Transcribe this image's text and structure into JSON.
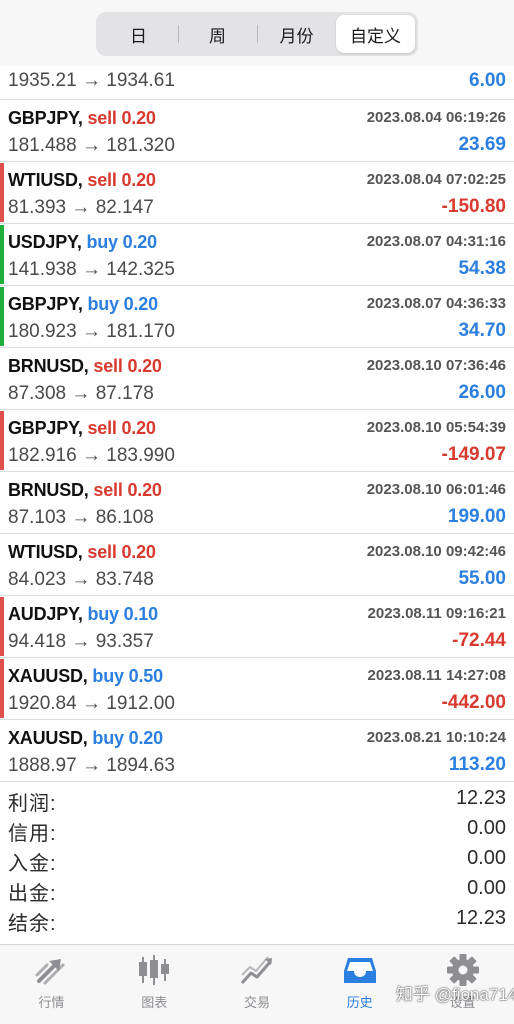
{
  "period_tabs": [
    {
      "label": "日"
    },
    {
      "label": "周"
    },
    {
      "label": "月份"
    },
    {
      "label": "自定义"
    }
  ],
  "active_period_index": 3,
  "partial_row": {
    "open": "1935.21",
    "close": "1934.61",
    "profit": "6.00"
  },
  "deals": [
    {
      "symbol": "GBPJPY,",
      "direction": "sell",
      "volume": "0.20",
      "time": "2023.08.04 06:19:26",
      "open": "181.488",
      "close": "181.320",
      "profit": "23.69",
      "indicator": "none"
    },
    {
      "symbol": "WTIUSD,",
      "direction": "sell",
      "volume": "0.20",
      "time": "2023.08.04 07:02:25",
      "open": "81.393",
      "close": "82.147",
      "profit": "-150.80",
      "indicator": "red"
    },
    {
      "symbol": "USDJPY,",
      "direction": "buy",
      "volume": "0.20",
      "time": "2023.08.07 04:31:16",
      "open": "141.938",
      "close": "142.325",
      "profit": "54.38",
      "indicator": "green"
    },
    {
      "symbol": "GBPJPY,",
      "direction": "buy",
      "volume": "0.20",
      "time": "2023.08.07 04:36:33",
      "open": "180.923",
      "close": "181.170",
      "profit": "34.70",
      "indicator": "green"
    },
    {
      "symbol": "BRNUSD,",
      "direction": "sell",
      "volume": "0.20",
      "time": "2023.08.10 07:36:46",
      "open": "87.308",
      "close": "87.178",
      "profit": "26.00",
      "indicator": "none"
    },
    {
      "symbol": "GBPJPY,",
      "direction": "sell",
      "volume": "0.20",
      "time": "2023.08.10 05:54:39",
      "open": "182.916",
      "close": "183.990",
      "profit": "-149.07",
      "indicator": "red"
    },
    {
      "symbol": "BRNUSD,",
      "direction": "sell",
      "volume": "0.20",
      "time": "2023.08.10 06:01:46",
      "open": "87.103",
      "close": "86.108",
      "profit": "199.00",
      "indicator": "none"
    },
    {
      "symbol": "WTIUSD,",
      "direction": "sell",
      "volume": "0.20",
      "time": "2023.08.10 09:42:46",
      "open": "84.023",
      "close": "83.748",
      "profit": "55.00",
      "indicator": "none"
    },
    {
      "symbol": "AUDJPY,",
      "direction": "buy",
      "volume": "0.10",
      "time": "2023.08.11 09:16:21",
      "open": "94.418",
      "close": "93.357",
      "profit": "-72.44",
      "indicator": "red"
    },
    {
      "symbol": "XAUUSD,",
      "direction": "buy",
      "volume": "0.50",
      "time": "2023.08.11 14:27:08",
      "open": "1920.84",
      "close": "1912.00",
      "profit": "-442.00",
      "indicator": "red"
    },
    {
      "symbol": "XAUUSD,",
      "direction": "buy",
      "volume": "0.20",
      "time": "2023.08.21 10:10:24",
      "open": "1888.97",
      "close": "1894.63",
      "profit": "113.20",
      "indicator": "none"
    }
  ],
  "arrow": "→",
  "summary": [
    {
      "label": "利润:",
      "value": "12.23"
    },
    {
      "label": "信用:",
      "value": "0.00"
    },
    {
      "label": "入金:",
      "value": "0.00"
    },
    {
      "label": "出金:",
      "value": "0.00"
    },
    {
      "label": "结余:",
      "value": "12.23"
    }
  ],
  "bottom_tabs": [
    {
      "label": "行情",
      "icon": "quotes-icon"
    },
    {
      "label": "图表",
      "icon": "candlestick-chart-icon"
    },
    {
      "label": "交易",
      "icon": "trade-trend-icon"
    },
    {
      "label": "历史",
      "icon": "history-inbox-icon"
    },
    {
      "label": "设置",
      "icon": "gear-icon"
    }
  ],
  "active_bottom_tab_index": 3,
  "watermark": "知乎 @fiona714",
  "colors": {
    "sell": "#d93a2f",
    "buy": "#2a7fe0",
    "profit_positive": "#2a7fe0",
    "profit_negative": "#d93a2f",
    "indicator_red": "#e0504d",
    "indicator_green": "#1fae3a",
    "tab_active": "#2a7fe0",
    "tab_inactive": "#8e8e93"
  }
}
